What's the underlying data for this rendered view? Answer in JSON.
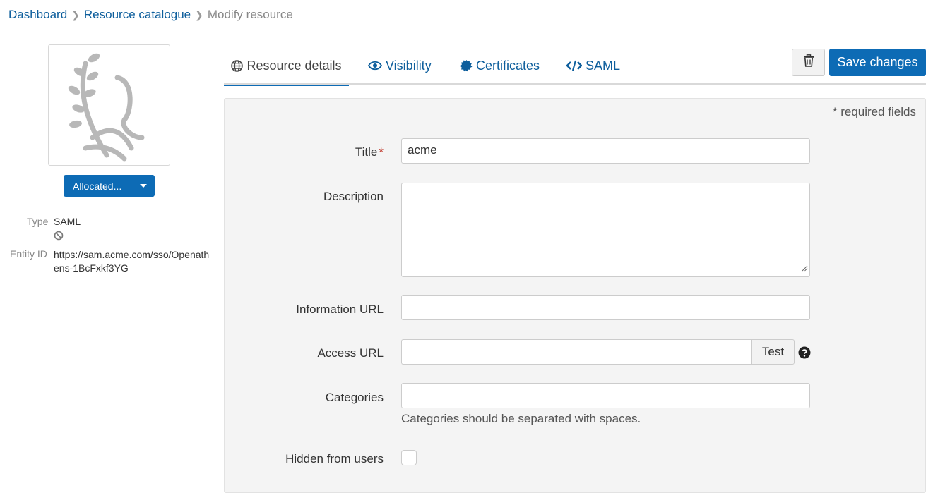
{
  "breadcrumb": {
    "items": [
      "Dashboard",
      "Resource catalogue"
    ],
    "current": "Modify resource"
  },
  "resource": {
    "logo_icon": "laurel-figure-placeholder",
    "status_button": "Allocated...",
    "type_label": "Type",
    "type_value": "SAML",
    "entity_label": "Entity ID",
    "entity_value": "https://sam.acme.com/sso/Openathens-1BcFxkf3YG"
  },
  "tabs": [
    {
      "label": "Resource details",
      "icon": "globe-icon",
      "active": true
    },
    {
      "label": "Visibility",
      "icon": "eye-icon",
      "active": false
    },
    {
      "label": "Certificates",
      "icon": "certificate-icon",
      "active": false
    },
    {
      "label": "SAML",
      "icon": "code-icon",
      "active": false
    }
  ],
  "toolbar": {
    "delete_icon": "trash-icon",
    "save_label": "Save changes"
  },
  "form": {
    "required_note": "* required fields",
    "title_label": "Title",
    "required_marker": "*",
    "title_value": "acme",
    "description_label": "Description",
    "description_value": "",
    "info_url_label": "Information URL",
    "info_url_value": "",
    "access_url_label": "Access URL",
    "access_url_value": "",
    "test_label": "Test",
    "categories_label": "Categories",
    "categories_value": "",
    "categories_hint": "Categories should be separated with spaces.",
    "hidden_label": "Hidden from users",
    "hidden_checked": false
  },
  "colors": {
    "primary": "#0d6bb5",
    "link": "#0d5e9c",
    "required": "#c0392b",
    "panel_bg": "#f4f4f4"
  }
}
